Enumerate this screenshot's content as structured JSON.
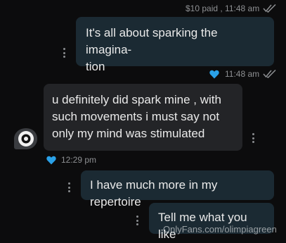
{
  "messages": [
    {
      "meta_text": "$10 paid , 11:48 am"
    },
    {
      "text_line1": "It's all about sparking the imagina-",
      "text_line2": "tion",
      "meta_text": "11:48 am"
    },
    {
      "text_line1": "u definitely did spark mine , with",
      "text_line2": "such movements i must say not",
      "text_line3": "only my mind was stimulated",
      "meta_text": "12:29 pm"
    },
    {
      "text": "I have much more in my repertoire"
    },
    {
      "text": "Tell me what you like"
    }
  ],
  "watermark": "OnlyFans.com/olimpiagreen",
  "colors": {
    "accent": "#2aa1e8",
    "outgoing_bubble": "#1b2a33",
    "incoming_bubble": "#232427",
    "background": "#0c0c0d"
  },
  "icons": [
    "double-check-icon",
    "heart-icon",
    "more-dots-icon",
    "avatar-icon"
  ]
}
